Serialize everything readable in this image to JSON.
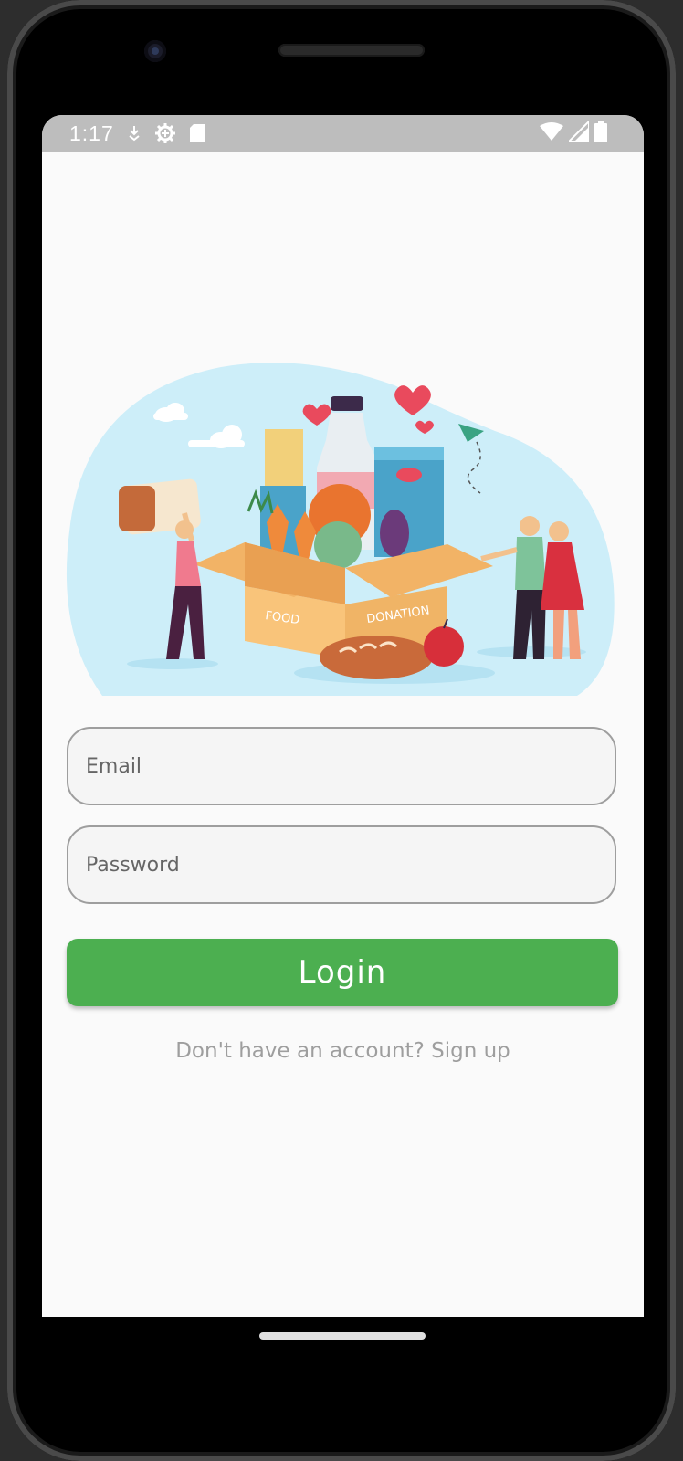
{
  "status_bar": {
    "time": "1:17",
    "left_icons": [
      "download-icon",
      "settings-gear-icon",
      "sd-card-icon"
    ],
    "right_icons": [
      "wifi-icon",
      "cell-signal-icon",
      "battery-icon"
    ]
  },
  "illustration": {
    "box_text_left": "FOOD",
    "box_text_right": "DONATION",
    "colors": {
      "blob": "#cdeef9",
      "box": "#f9c47a",
      "heart": "#e94a5d"
    }
  },
  "form": {
    "email_placeholder": "Email",
    "password_placeholder": "Password",
    "login_label": "Login",
    "signup_text": "Don't have an account? Sign up"
  },
  "colors": {
    "accent": "#4caf50",
    "status_bar": "#bdbdbd",
    "background": "#fafafa"
  }
}
